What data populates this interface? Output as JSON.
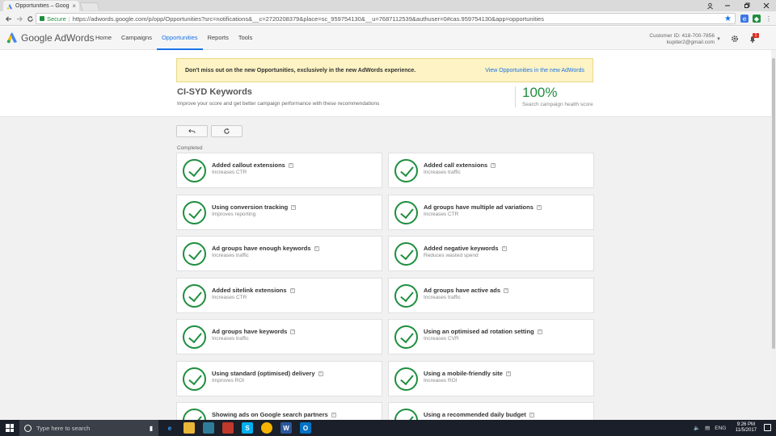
{
  "browser": {
    "tab_title": "Opportunities – Google ×",
    "tab_close": "×",
    "secure_label": "Secure",
    "url": "https://adwords.google.com/p/opp/Opportunities?src=notifications&__c=2720208379&place=sc_959754130&__u=7687112539&authuser=0#cas.959754130&app=opportunities"
  },
  "header": {
    "logo_text": "Google AdWords",
    "nav": [
      "Home",
      "Campaigns",
      "Opportunities",
      "Reports",
      "Tools"
    ],
    "active_nav": "Opportunities",
    "customer_id": "Customer ID: 418-700-7856",
    "customer_email": "kupiter2@gmail.com",
    "notification_count": "1"
  },
  "banner": {
    "text": "Don't miss out on the new Opportunities, exclusively in the new AdWords experience.",
    "link": "View Opportunities in the new AdWords"
  },
  "account": {
    "title": "CI-SYD Keywords",
    "subtitle": "Improve your score and get better campaign performance with these recommendations",
    "score": "100%",
    "score_label": "Search campaign health score"
  },
  "section_label": "Completed",
  "help_glyph": "?",
  "cards": [
    {
      "title": "Added callout extensions",
      "sub": "Increases CTR"
    },
    {
      "title": "Added call extensions",
      "sub": "Increases traffic"
    },
    {
      "title": "Using conversion tracking",
      "sub": "Improves reporting"
    },
    {
      "title": "Ad groups have multiple ad variations",
      "sub": "Increases CTR"
    },
    {
      "title": "Ad groups have enough keywords",
      "sub": "Increases traffic"
    },
    {
      "title": "Added negative keywords",
      "sub": "Reduces wasted spend"
    },
    {
      "title": "Added sitelink extensions",
      "sub": "Increases CTR"
    },
    {
      "title": "Ad groups have active ads",
      "sub": "Increases traffic"
    },
    {
      "title": "Ad groups have keywords",
      "sub": "Increases traffic"
    },
    {
      "title": "Using an optimised ad rotation setting",
      "sub": "Increases CVR"
    },
    {
      "title": "Using standard (optimised) delivery",
      "sub": "Improves ROI"
    },
    {
      "title": "Using a mobile-friendly site",
      "sub": "Increases ROI"
    },
    {
      "title": "Showing ads on Google search partners",
      "sub": ""
    },
    {
      "title": "Using a recommended daily budget",
      "sub": ""
    }
  ],
  "taskbar": {
    "search_placeholder": "Type here to search",
    "lang": "ENG",
    "time": "9:26 PM",
    "date": "11/5/2017"
  },
  "colors": {
    "accent": "#1a73e8",
    "success": "#1e8e3e",
    "banner_bg": "#fdf3c4"
  }
}
